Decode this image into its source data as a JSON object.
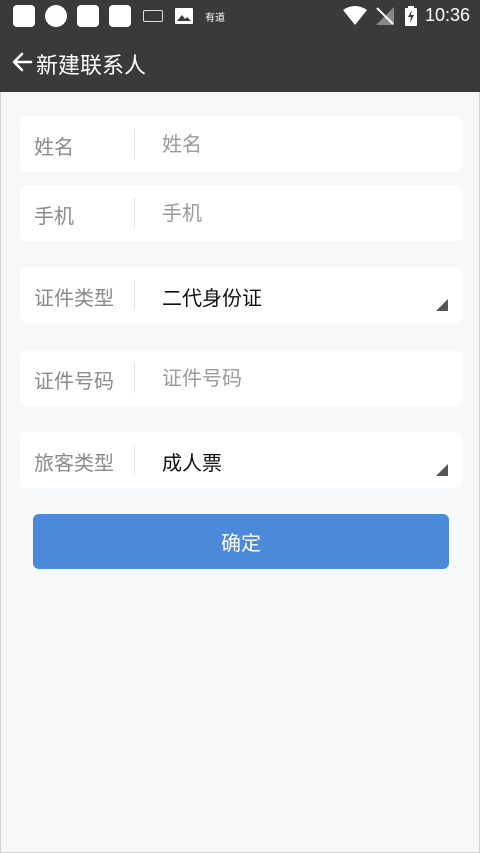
{
  "status_bar": {
    "time": "10:36",
    "youdao_label": "有道",
    "icons": [
      "app-square-icon",
      "app-circle-icon",
      "app-square-icon",
      "app-square-icon",
      "keyboard-icon",
      "image-icon",
      "youdao-icon",
      "wifi-icon",
      "no-signal-icon",
      "battery-charging-icon"
    ]
  },
  "app_bar": {
    "title": "新建联系人"
  },
  "form": {
    "name": {
      "label": "姓名",
      "placeholder": "姓名",
      "value": ""
    },
    "phone": {
      "label": "手机",
      "placeholder": "手机",
      "value": ""
    },
    "id_type": {
      "label": "证件类型",
      "value": "二代身份证"
    },
    "id_number": {
      "label": "证件号码",
      "placeholder": "证件号码",
      "value": ""
    },
    "passenger_type": {
      "label": "旅客类型",
      "value": "成人票"
    }
  },
  "confirm_label": "确定",
  "colors": {
    "app_bar": "#3a3a3a",
    "accent": "#4a8ad9",
    "background": "#f7f8fa"
  }
}
